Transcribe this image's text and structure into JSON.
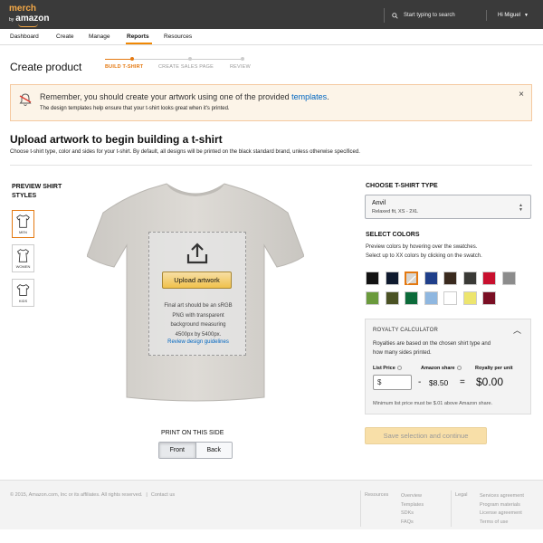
{
  "header": {
    "logo_top": "merch",
    "logo_by": "by",
    "logo_bottom": "amazon",
    "search_placeholder": "Start typing to search",
    "user": "Hi Miguel"
  },
  "nav": {
    "items": [
      "Dashboard",
      "Create",
      "Manage",
      "Reports",
      "Resources"
    ],
    "active": "Reports"
  },
  "page": {
    "title": "Create product",
    "steps": [
      "BUILD T-SHIRT",
      "CREATE SALES PAGE",
      "REVIEW"
    ],
    "active_step": "BUILD T-SHIRT"
  },
  "notice": {
    "text_before": "Remember, you should create your artwork using one of the provided ",
    "link": "templates",
    "text_after": ".",
    "subtext": "The design templates help ensure that your t-shirt looks great when it's printed.",
    "close": "×"
  },
  "upload": {
    "title": "Upload artwork to begin building a t-shirt",
    "description": "Choose t-shirt type, color and sides for your t-shirt. By default, all designs will be printed on the black standard brand, unless otherwise specificed."
  },
  "preview": {
    "title": "PREVIEW SHIRT STYLES",
    "styles": [
      "MEN",
      "WOMEN",
      "KIDS"
    ],
    "selected": "MEN"
  },
  "artwork": {
    "button": "Upload artwork",
    "line1": "Final art should be an sRGB",
    "line2": "PNG with transparent",
    "line3": "background measuring",
    "line4": "4500px by 5400px.",
    "link": "Review design guidelines"
  },
  "print_side": {
    "title": "PRINT ON THIS SIDE",
    "options": [
      "Front",
      "Back"
    ],
    "selected": "Front"
  },
  "tshirt_type": {
    "title": "CHOOSE T-SHIRT TYPE",
    "value": "Anvil",
    "sub": "Relaxed fit, XS - 2XL"
  },
  "colors": {
    "title": "SELECT COLORS",
    "line1": "Preview colors by hovering over the swatches.",
    "line2": "Select up to XX colors by clicking on the swatch.",
    "swatches": [
      "#111111",
      "#0f1a2e",
      "#d9d6d1",
      "#1f3f8a",
      "#3a2a1e",
      "#3a3a36",
      "#c8102e",
      "#8c8c8c",
      "#6a9a3c",
      "#4a5224",
      "#0c6b3a",
      "#8fb7e0",
      "#ffffff",
      "#ede56e",
      "#7a0f24"
    ],
    "selected_index": 2
  },
  "royalty": {
    "title": "ROYALTY CALCULATOR",
    "caret": "^",
    "line1": "Royalties are based on the chosen shirt type and",
    "line2": "how many sides printed.",
    "list_price_label": "List Price",
    "amazon_share_label": "Amazon share",
    "royalty_label": "Royalty per unit",
    "currency": "$",
    "minus": "-",
    "amazon_share": "$8.50",
    "equals": "=",
    "royalty_value": "$0.00",
    "minimum": "Minimum list price must be $.01 above Amazon share."
  },
  "save_button": "Save selection and continue",
  "footer": {
    "copyright": "© 2015, Amazon.com, Inc or its affiliates. All rights reserved.",
    "separator": "|",
    "contact": "Contact us",
    "resources_title": "Resources",
    "resources_links": [
      "Overview",
      "Templates",
      "SDKs",
      "FAQs"
    ],
    "legal_title": "Legal",
    "legal_links": [
      "Services agreement",
      "Program materials",
      "License agreement",
      "Terms of use"
    ]
  }
}
